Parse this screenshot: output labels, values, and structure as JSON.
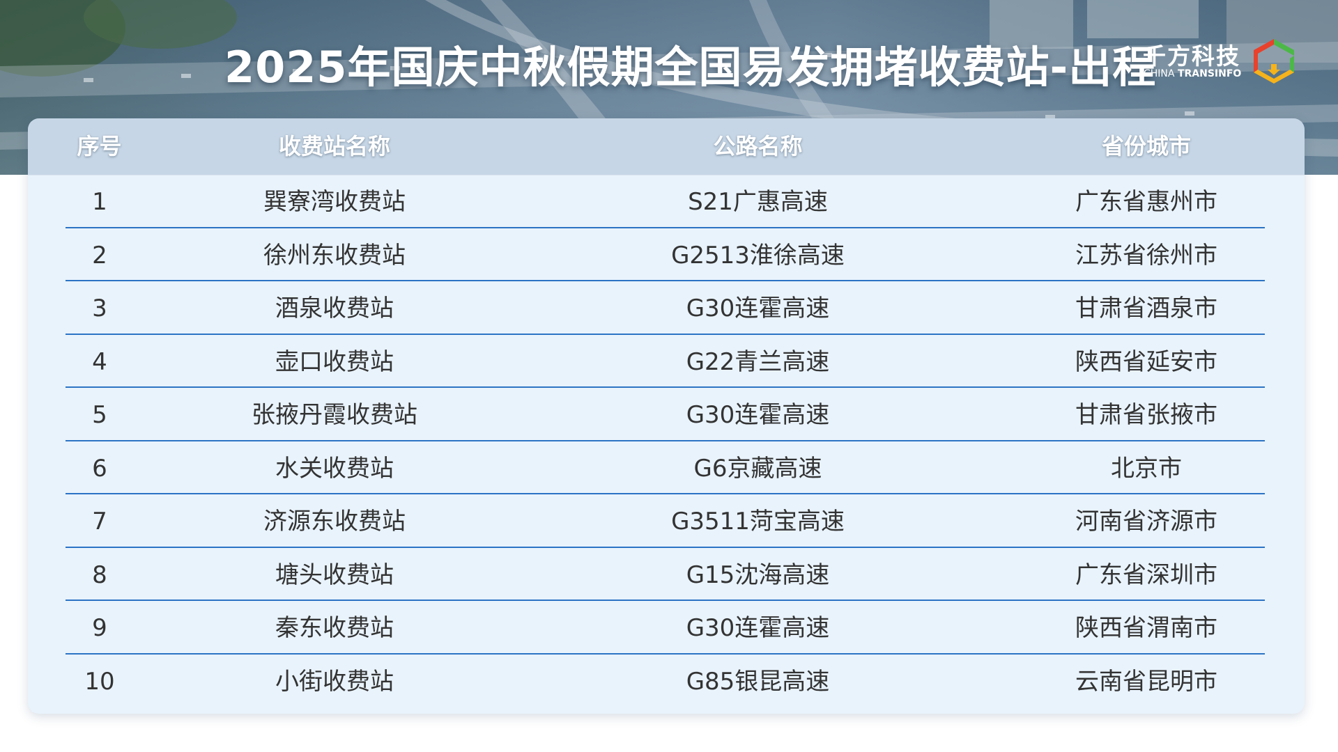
{
  "title": "2025年国庆中秋假期全国易发拥堵收费站-出程",
  "logo": {
    "name_cn": "千方科技",
    "name_en_light": "CHINA ",
    "name_en_bold": "TRANSINFO"
  },
  "colors": {
    "row_divider": "#2b73c4",
    "table_bg": "#e9f3fc",
    "logo_red": "#e8412c",
    "logo_green": "#4cb847",
    "logo_yellow": "#f6b31b"
  },
  "table": {
    "headers": [
      "序号",
      "收费站名称",
      "公路名称",
      "省份城市"
    ],
    "rows": [
      {
        "index": "1",
        "station": "巽寮湾收费站",
        "highway": "S21广惠高速",
        "province": "广东省惠州市"
      },
      {
        "index": "2",
        "station": "徐州东收费站",
        "highway": "G2513淮徐高速",
        "province": "江苏省徐州市"
      },
      {
        "index": "3",
        "station": "酒泉收费站",
        "highway": "G30连霍高速",
        "province": "甘肃省酒泉市"
      },
      {
        "index": "4",
        "station": "壶口收费站",
        "highway": "G22青兰高速",
        "province": "陕西省延安市"
      },
      {
        "index": "5",
        "station": "张掖丹霞收费站",
        "highway": "G30连霍高速",
        "province": "甘肃省张掖市"
      },
      {
        "index": "6",
        "station": "水关收费站",
        "highway": "G6京藏高速",
        "province": "北京市"
      },
      {
        "index": "7",
        "station": "济源东收费站",
        "highway": "G3511菏宝高速",
        "province": "河南省济源市"
      },
      {
        "index": "8",
        "station": "塘头收费站",
        "highway": "G15沈海高速",
        "province": "广东省深圳市"
      },
      {
        "index": "9",
        "station": "秦东收费站",
        "highway": "G30连霍高速",
        "province": "陕西省渭南市"
      },
      {
        "index": "10",
        "station": "小街收费站",
        "highway": "G85银昆高速",
        "province": "云南省昆明市"
      }
    ]
  }
}
